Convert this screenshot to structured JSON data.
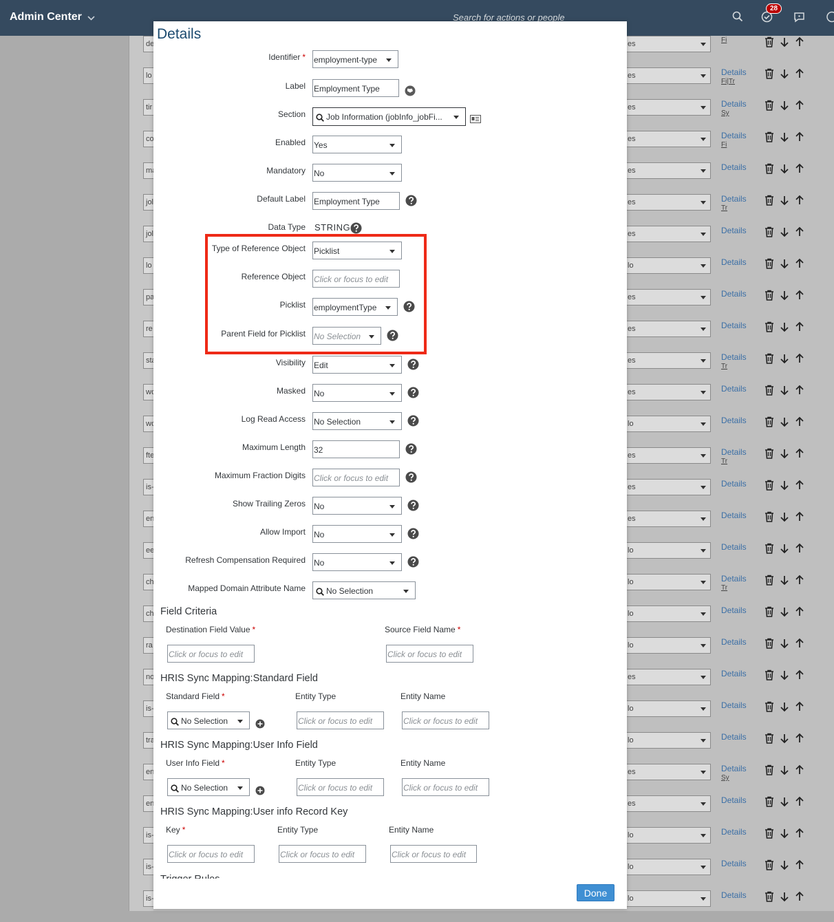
{
  "shell": {
    "app_title": "Admin Center",
    "search_placeholder": "Search for actions or people",
    "notification_count": "28",
    "colors": {
      "header_bg": "#354a5f",
      "badge": "#bb0000",
      "highlight": "#ee2a17",
      "done_button": "#3f8fd3"
    }
  },
  "background_list": {
    "rows": [
      {
        "name": "de",
        "value": "es",
        "details": "",
        "sub": "Fi"
      },
      {
        "name": "lo",
        "value": "es",
        "details": "Details",
        "sub": "Fi|Tr"
      },
      {
        "name": "tir",
        "value": "es",
        "details": "Details",
        "sub": "Sy"
      },
      {
        "name": "co",
        "value": "es",
        "details": "Details",
        "sub": "Fi"
      },
      {
        "name": "ma",
        "value": "es",
        "details": "Details",
        "sub": ""
      },
      {
        "name": "jol",
        "value": "es",
        "details": "Details",
        "sub": "Tr"
      },
      {
        "name": "jol",
        "value": "es",
        "details": "Details",
        "sub": ""
      },
      {
        "name": "lo",
        "value": "lo",
        "details": "Details",
        "sub": ""
      },
      {
        "name": "pa",
        "value": "es",
        "details": "Details",
        "sub": ""
      },
      {
        "name": "re",
        "value": "es",
        "details": "Details",
        "sub": ""
      },
      {
        "name": "sta",
        "value": "es",
        "details": "Details",
        "sub": "Tr"
      },
      {
        "name": "wo",
        "value": "es",
        "details": "Details",
        "sub": ""
      },
      {
        "name": "wo",
        "value": "lo",
        "details": "Details",
        "sub": ""
      },
      {
        "name": "fte",
        "value": "es",
        "details": "Details",
        "sub": "Tr"
      },
      {
        "name": "is-",
        "value": "es",
        "details": "Details",
        "sub": ""
      },
      {
        "name": "en",
        "value": "es",
        "details": "Details",
        "sub": ""
      },
      {
        "name": "ee",
        "value": "lo",
        "details": "Details",
        "sub": ""
      },
      {
        "name": "ch",
        "value": "lo",
        "details": "Details",
        "sub": "Tr"
      },
      {
        "name": "ch",
        "value": "lo",
        "details": "Details",
        "sub": ""
      },
      {
        "name": "ra",
        "value": "lo",
        "details": "Details",
        "sub": ""
      },
      {
        "name": "no",
        "value": "es",
        "details": "Details",
        "sub": ""
      },
      {
        "name": "is-",
        "value": "lo",
        "details": "Details",
        "sub": ""
      },
      {
        "name": "tra",
        "value": "lo",
        "details": "Details",
        "sub": ""
      },
      {
        "name": "en",
        "value": "es",
        "details": "Details",
        "sub": "Sy"
      },
      {
        "name": "en",
        "value": "es",
        "details": "Details",
        "sub": ""
      },
      {
        "name": "is-",
        "value": "lo",
        "details": "Details",
        "sub": ""
      },
      {
        "name": "is-",
        "value": "lo",
        "details": "Details",
        "sub": ""
      },
      {
        "name": "is-",
        "value": "lo",
        "details": "Details",
        "sub": ""
      }
    ]
  },
  "dialog": {
    "title": "Details",
    "fields": {
      "identifier": {
        "label": "Identifier",
        "value": "employment-type"
      },
      "label": {
        "label": "Label",
        "value": "Employment Type"
      },
      "section": {
        "label": "Section",
        "value": "Job Information (jobInfo_jobFi..."
      },
      "enabled": {
        "label": "Enabled",
        "value": "Yes"
      },
      "mandatory": {
        "label": "Mandatory",
        "value": "No"
      },
      "default_label": {
        "label": "Default Label",
        "value": "Employment Type"
      },
      "data_type": {
        "label": "Data Type",
        "value": "STRING"
      },
      "type_of_reference_object": {
        "label": "Type of Reference Object",
        "value": "Picklist"
      },
      "reference_object": {
        "label": "Reference Object",
        "placeholder": "Click or focus to edit"
      },
      "picklist": {
        "label": "Picklist",
        "value": "employmentType"
      },
      "parent_field_for_picklist": {
        "label": "Parent Field for Picklist",
        "placeholder": "No Selection"
      },
      "visibility": {
        "label": "Visibility",
        "value": "Edit"
      },
      "masked": {
        "label": "Masked",
        "value": "No"
      },
      "log_read_access": {
        "label": "Log Read Access",
        "value": "No Selection"
      },
      "maximum_length": {
        "label": "Maximum Length",
        "value": "32"
      },
      "maximum_fraction_digits": {
        "label": "Maximum Fraction Digits",
        "placeholder": "Click or focus to edit"
      },
      "show_trailing_zeros": {
        "label": "Show Trailing Zeros",
        "value": "No"
      },
      "allow_import": {
        "label": "Allow Import",
        "value": "No"
      },
      "refresh_compensation_required": {
        "label": "Refresh Compensation Required",
        "value": "No"
      },
      "mapped_domain_attribute_name": {
        "label": "Mapped Domain Attribute Name",
        "value": "No Selection"
      }
    },
    "field_criteria": {
      "title": "Field Criteria",
      "destination_label": "Destination Field Value",
      "destination_placeholder": "Click or focus to edit",
      "source_label": "Source Field Name",
      "source_placeholder": "Click or focus to edit"
    },
    "hris_standard": {
      "title": "HRIS Sync Mapping:Standard Field",
      "field_label": "Standard Field",
      "field_value": "No Selection",
      "entity_type_label": "Entity Type",
      "entity_type_placeholder": "Click or focus to edit",
      "entity_name_label": "Entity Name",
      "entity_name_placeholder": "Click or focus to edit"
    },
    "hris_user_info": {
      "title": "HRIS Sync Mapping:User Info Field",
      "field_label": "User Info Field",
      "field_value": "No Selection",
      "entity_type_label": "Entity Type",
      "entity_type_placeholder": "Click or focus to edit",
      "entity_name_label": "Entity Name",
      "entity_name_placeholder": "Click or focus to edit"
    },
    "hris_record_key": {
      "title": "HRIS Sync Mapping:User info Record Key",
      "key_label": "Key",
      "key_placeholder": "Click or focus to edit",
      "entity_type_label": "Entity Type",
      "entity_type_placeholder": "Click or focus to edit",
      "entity_name_label": "Entity Name",
      "entity_name_placeholder": "Click or focus to edit"
    },
    "clipped_section_title": "Trigger Rules",
    "done_label": "Done"
  }
}
